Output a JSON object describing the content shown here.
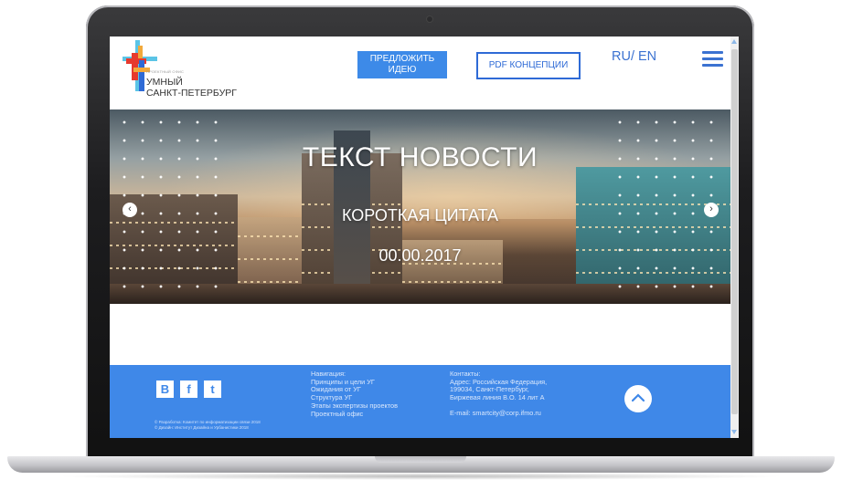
{
  "logo": {
    "small_text": "ПРОЕКТНЫЙ ОФИС",
    "line1": "УМНЫЙ",
    "line2": "САНКТ-ПЕТЕРБУРГ",
    "colors": [
      "#e63a2e",
      "#f2a93b",
      "#2e6ad6",
      "#5bc4e6"
    ]
  },
  "header": {
    "idea_button_line1": "ПРЕДЛОЖИТЬ",
    "idea_button_line2": "ИДЕЮ",
    "pdf_button": "PDF КОНЦЕПЦИИ",
    "lang": "RU/ EN",
    "menu_icon": "hamburger-icon"
  },
  "hero": {
    "title": "ТЕКСТ НОВОСТИ",
    "quote": "КОРОТКАЯ ЦИТАТА",
    "date": "00.00.2017",
    "prev_arrow": "‹",
    "next_arrow": "›"
  },
  "footer": {
    "social": [
      {
        "label": "B",
        "icon": "vk-icon"
      },
      {
        "label": "f",
        "icon": "facebook-icon"
      },
      {
        "label": "t",
        "icon": "twitter-icon"
      }
    ],
    "copyright_line1": "© Разработка: Комитет по информатизации связи 2018",
    "copyright_line2": "© Дизайн: Институт Дизайна и Урбанистики 2018",
    "nav": [
      "Навигация:",
      "Принципы и цели УГ",
      "Ожидания от УГ",
      "Структура УГ",
      "Этапы экспертизы проектов",
      "Проектный офис"
    ],
    "contacts_title": "Контакты:",
    "address_line1": "Адрес: Российская Федерация,",
    "address_line2": "199034, Санкт-Петербург,",
    "address_line3": "Биржевая линия В.О. 14 лит А",
    "email": "E-mail: smartcity@corp.ifmo.ru",
    "up_icon": "chevron-up-icon"
  },
  "colors": {
    "accent": "#3f88e8",
    "button_blue": "#3d8ae8",
    "outline_blue": "#2e6ad6"
  }
}
